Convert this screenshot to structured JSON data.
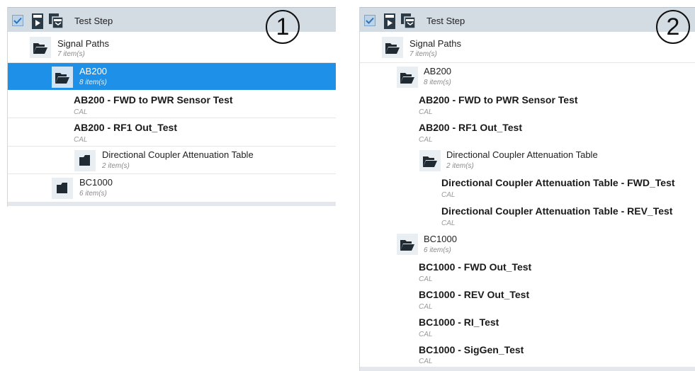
{
  "panel1": {
    "header": {
      "title": "Test Step"
    },
    "badge": "1",
    "rows": [
      {
        "label": "Signal Paths",
        "count": "7 item(s)"
      },
      {
        "label": "AB200",
        "count": "8 item(s)"
      },
      {
        "name": "AB200 - FWD to PWR Sensor Test",
        "sub": "CAL"
      },
      {
        "name": "AB200 - RF1 Out_Test",
        "sub": "CAL"
      },
      {
        "label": "Directional Coupler Attenuation Table",
        "count": "2 item(s)"
      },
      {
        "label": "BC1000",
        "count": "6 item(s)"
      }
    ]
  },
  "panel2": {
    "header": {
      "title": "Test Step"
    },
    "badge": "2",
    "rows": [
      {
        "label": "Signal Paths",
        "count": "7 item(s)"
      },
      {
        "label": "AB200",
        "count": "8 item(s)"
      },
      {
        "name": "AB200 - FWD to PWR Sensor Test",
        "sub": "CAL"
      },
      {
        "name": "AB200 - RF1 Out_Test",
        "sub": "CAL"
      },
      {
        "label": "Directional Coupler Attenuation Table",
        "count": "2 item(s)"
      },
      {
        "name": "Directional Coupler Attenuation Table - FWD_Test",
        "sub": "CAL"
      },
      {
        "name": "Directional Coupler Attenuation Table - REV_Test",
        "sub": "CAL"
      },
      {
        "label": "BC1000",
        "count": "6 item(s)"
      },
      {
        "name": "BC1000 - FWD Out_Test",
        "sub": "CAL"
      },
      {
        "name": "BC1000 - REV Out_Test",
        "sub": "CAL"
      },
      {
        "name": "BC1000 - RI_Test",
        "sub": "CAL"
      },
      {
        "name": "BC1000 - SigGen_Test",
        "sub": "CAL"
      }
    ]
  }
}
